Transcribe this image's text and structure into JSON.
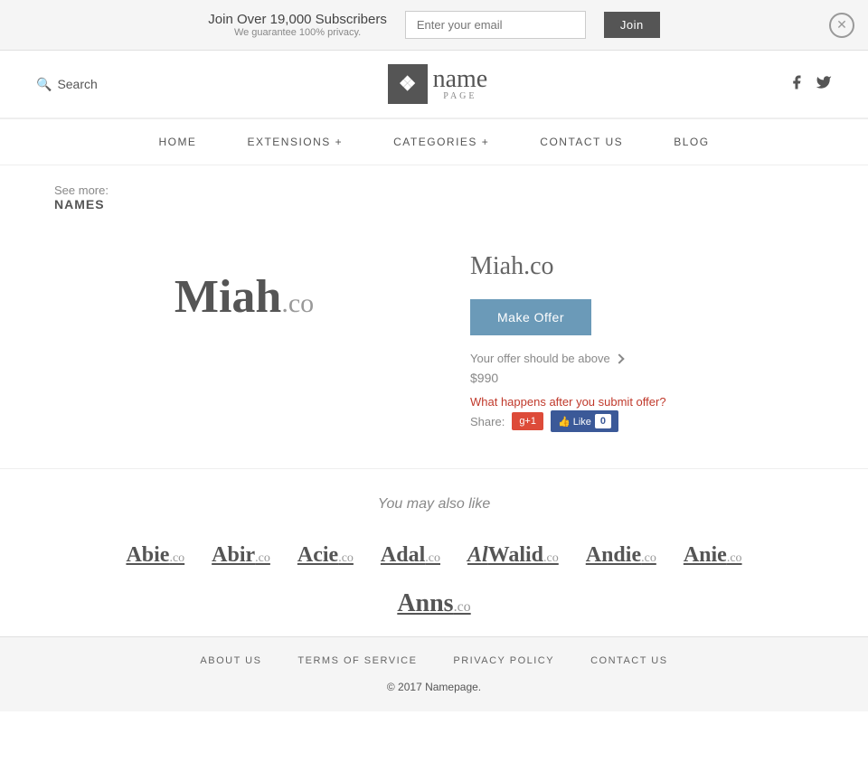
{
  "banner": {
    "headline": "Join Over 19,000 Subscribers",
    "subline": "We guarantee 100% privacy.",
    "email_placeholder": "Enter your email",
    "join_label": "Join"
  },
  "header": {
    "search_label": "Search",
    "logo_icon": "N",
    "logo_name": "name",
    "logo_page": "PAGE"
  },
  "nav": {
    "items": [
      {
        "label": "HOME",
        "id": "home"
      },
      {
        "label": "EXTENSIONS +",
        "id": "extensions"
      },
      {
        "label": "CATEGORIES +",
        "id": "categories"
      },
      {
        "label": "CONTACT US",
        "id": "contact"
      },
      {
        "label": "BLOG",
        "id": "blog"
      }
    ]
  },
  "breadcrumb": {
    "see_more": "See more:",
    "names_label": "NAMES"
  },
  "domain": {
    "name_bold": "Miah",
    "tld": ".co",
    "full": "Miah.co",
    "make_offer_label": "Make Offer",
    "offer_info": "Your offer should be above",
    "offer_amount": "$990",
    "what_happens": "What happens after you submit offer?",
    "share_label": "Share:"
  },
  "also_like": {
    "title": "You may also like",
    "domains": [
      {
        "name": "Abie",
        "tld": ".co"
      },
      {
        "name": "Abir",
        "tld": ".co"
      },
      {
        "name": "Acie",
        "tld": ".co"
      },
      {
        "name": "Adal",
        "tld": ".co"
      },
      {
        "name": "AlWalid",
        "tld": ".co"
      },
      {
        "name": "Andie",
        "tld": ".co"
      },
      {
        "name": "Anie",
        "tld": ".co"
      }
    ],
    "bottom_domain": {
      "name": "Anns",
      "tld": ".co"
    }
  },
  "footer": {
    "links": [
      {
        "label": "ABOUT US",
        "id": "about"
      },
      {
        "label": "TERMS OF SERVICE",
        "id": "terms"
      },
      {
        "label": "PRIVACY POLICY",
        "id": "privacy"
      },
      {
        "label": "CONTACT US",
        "id": "contact"
      }
    ],
    "copyright": "© 2017 Namepage."
  }
}
